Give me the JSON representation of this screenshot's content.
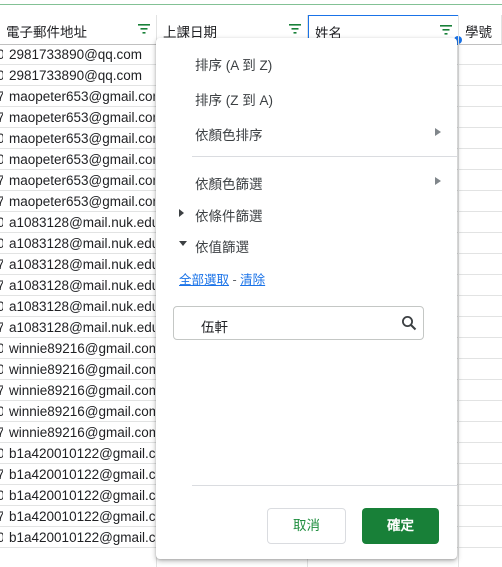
{
  "headers": {
    "email": "電子郵件地址",
    "date": "上課日期",
    "name": "姓名",
    "id": "學號"
  },
  "rows": [
    "2981733890@qq.com",
    "2981733890@qq.com",
    "maopeter653@gmail.com",
    "maopeter653@gmail.com",
    "maopeter653@gmail.com",
    "maopeter653@gmail.com",
    "maopeter653@gmail.com",
    "maopeter653@gmail.com",
    "a1083128@mail.nuk.edu.tw",
    "a1083128@mail.nuk.edu.tw",
    "a1083128@mail.nuk.edu.tw",
    "a1083128@mail.nuk.edu.tw",
    "a1083128@mail.nuk.edu.tw",
    "a1083128@mail.nuk.edu.tw",
    "winnie89216@gmail.com",
    "winnie89216@gmail.com",
    "winnie89216@gmail.com",
    "winnie89216@gmail.com",
    "winnie89216@gmail.com",
    "b1a420010122@gmail.com",
    "b1a420010122@gmail.com",
    "b1a420010122@gmail.com",
    "b1a420010122@gmail.com",
    "b1a420010122@gmail.com"
  ],
  "row_edge_digits": [
    "0",
    "0",
    "7",
    "7",
    "0",
    "0",
    "7",
    "7",
    "0",
    "0",
    "7",
    "7",
    "0",
    "7",
    "0",
    "0",
    "7",
    "0",
    "7",
    "0",
    "7",
    "0",
    "7",
    "0"
  ],
  "menu": {
    "sort_az": "排序 (A 到 Z)",
    "sort_za": "排序 (Z 到 A)",
    "sort_by_color": "依顏色排序",
    "filter_by_color": "依顏色篩選",
    "filter_by_condition": "依條件篩選",
    "filter_by_values": "依值篩選",
    "select_all": "全部選取",
    "link_separator": " - ",
    "clear": "清除",
    "search_value": "伍軒",
    "cancel": "取消",
    "ok": "確定"
  },
  "colors": {
    "accent_green": "#188038",
    "selection_blue": "#1a73e8"
  }
}
